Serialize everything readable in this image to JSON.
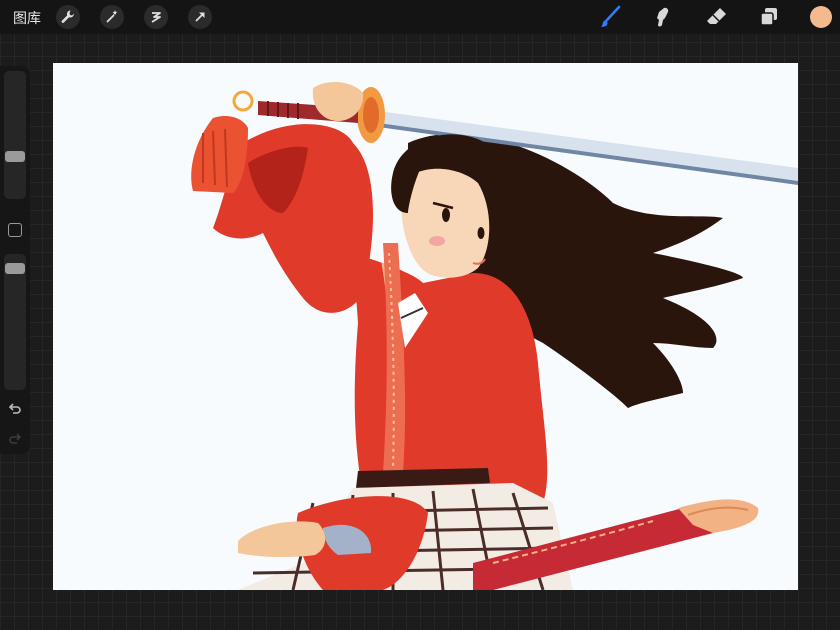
{
  "topbar": {
    "gallery_label": "图库",
    "tools_left": [
      "wrench-icon",
      "magic-wand-icon",
      "selection-icon",
      "transform-arrow-icon"
    ],
    "tools_right": [
      "brush-icon",
      "smudge-icon",
      "eraser-icon",
      "layers-icon"
    ],
    "active_tool": "brush-icon",
    "active_tool_color": "#2f7cf6",
    "current_color": "#f4b98d"
  },
  "sidebar": {
    "brush_size_level": 0.55,
    "opacity_level": 0.9,
    "icons": [
      "modify-square-icon",
      "undo-icon",
      "redo-icon"
    ]
  },
  "canvas": {
    "artwork": "mulan-illustration"
  }
}
